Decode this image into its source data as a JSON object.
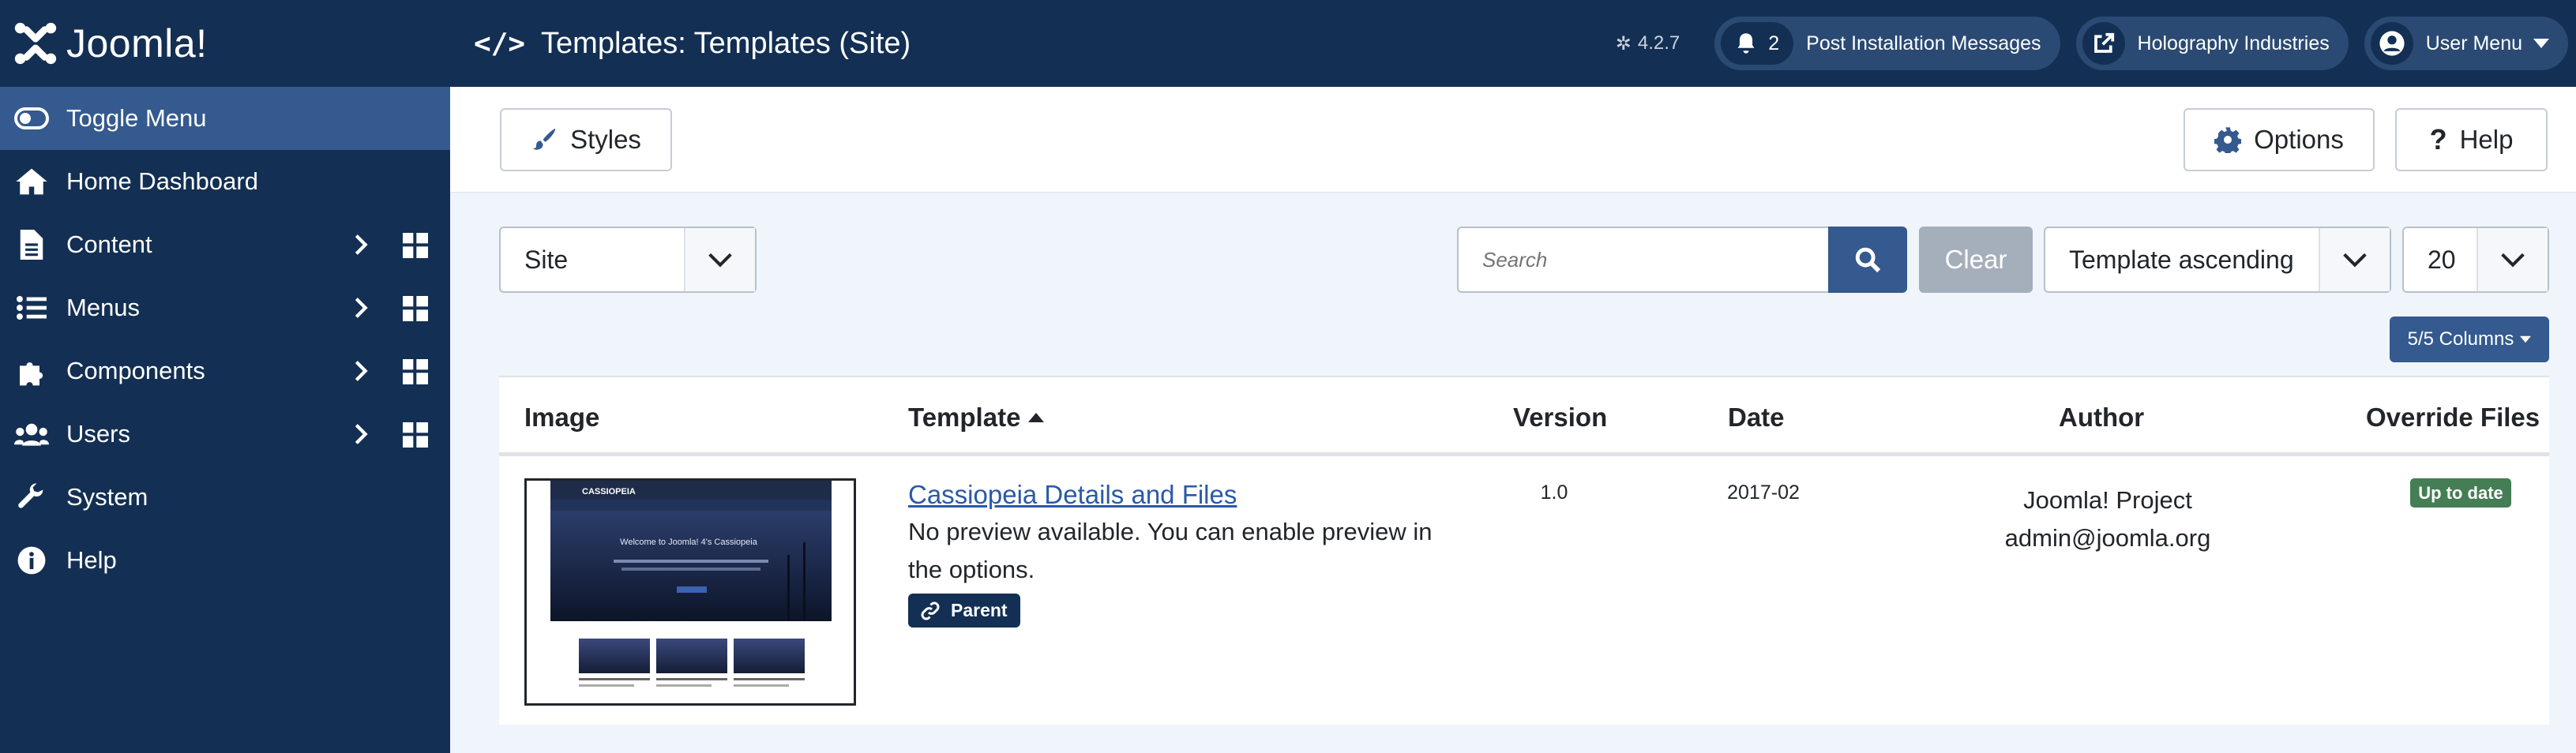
{
  "header": {
    "brand": "Joomla!",
    "title": "Templates: Templates (Site)",
    "version": "4.2.7",
    "messages_count": "2",
    "messages_label": "Post Installation Messages",
    "site_label": "Holography Industries",
    "user_label": "User Menu"
  },
  "sidebar": {
    "items": [
      {
        "label": "Toggle Menu",
        "icon": "toggle-icon"
      },
      {
        "label": "Home Dashboard",
        "icon": "home-icon"
      },
      {
        "label": "Content",
        "icon": "file-icon"
      },
      {
        "label": "Menus",
        "icon": "list-icon"
      },
      {
        "label": "Components",
        "icon": "puzzle-icon"
      },
      {
        "label": "Users",
        "icon": "users-icon"
      },
      {
        "label": "System",
        "icon": "wrench-icon"
      },
      {
        "label": "Help",
        "icon": "info-icon"
      }
    ]
  },
  "toolbar": {
    "styles_label": "Styles",
    "options_label": "Options",
    "help_label": "Help"
  },
  "filters": {
    "client_value": "Site",
    "search_placeholder": "Search",
    "clear_label": "Clear",
    "sort_value": "Template ascending",
    "limit_value": "20",
    "columns_label": "5/5 Columns"
  },
  "table": {
    "columns": [
      "Image",
      "Template",
      "Version",
      "Date",
      "Author",
      "Override Files"
    ],
    "rows": [
      {
        "template_name": "Cassiopeia Details and Files",
        "preview_note": "No preview available. You can enable preview in the options.",
        "parent_label": "Parent",
        "version": "1.0",
        "date": "2017-02",
        "author_name": "Joomla! Project",
        "author_email": "admin@joomla.org",
        "status": "Up to date",
        "thumb": {
          "site_name": "CASSIOPEIA",
          "hero_text": "Welcome to Joomla! 4's Cassiopeia"
        }
      }
    ]
  },
  "colors": {
    "header_bg": "#132f53",
    "accent": "#345a8f",
    "success": "#457d54",
    "link": "#2a5aa6"
  }
}
